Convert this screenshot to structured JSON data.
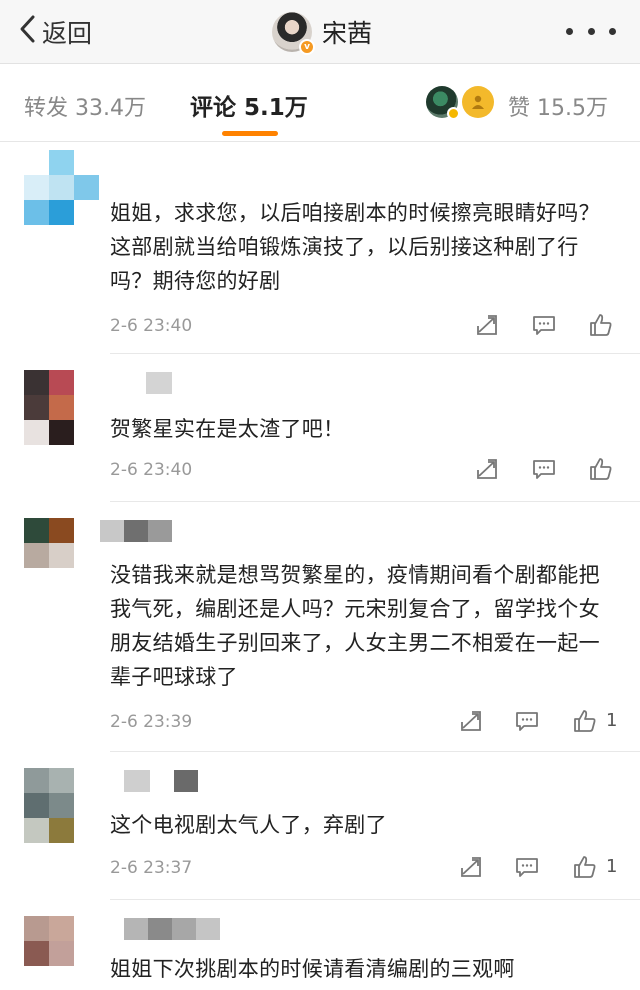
{
  "nav": {
    "back_label": "返回",
    "title": "宋茜",
    "verified_badge": "v",
    "icons": {
      "back": "chevron-left-icon",
      "more": "more-dots-icon"
    }
  },
  "stats": {
    "repost": "转发 33.4万",
    "comment": "评论 5.1万",
    "like": "赞 15.5万",
    "accent_color": "#ff8200"
  },
  "comments": [
    {
      "text": "姐姐，求求您，以后咱接剧本的时候擦亮眼睛好吗？这部剧就当给咱锻炼演技了，以后别接这种剧了行吗？期待您的好剧",
      "time": "2-6 23:40",
      "likes": ""
    },
    {
      "text": "贺繁星实在是太渣了吧！",
      "time": "2-6 23:40",
      "likes": ""
    },
    {
      "text": "没错我来就是想骂贺繁星的，疫情期间看个剧都能把我气死，编剧还是人吗？元宋别复合了，留学找个女朋友结婚生子别回来了，人女主男二不相爱在一起一辈子吧球球了",
      "time": "2-6 23:39",
      "likes": "1"
    },
    {
      "text": "这个电视剧太气人了，弃剧了",
      "time": "2-6 23:37",
      "likes": "1"
    },
    {
      "text": "姐姐下次挑剧本的时候请看清编剧的三观啊",
      "time": "",
      "likes": ""
    }
  ],
  "action_icons": [
    "repost-icon",
    "comment-icon",
    "thumbs-up-icon"
  ]
}
